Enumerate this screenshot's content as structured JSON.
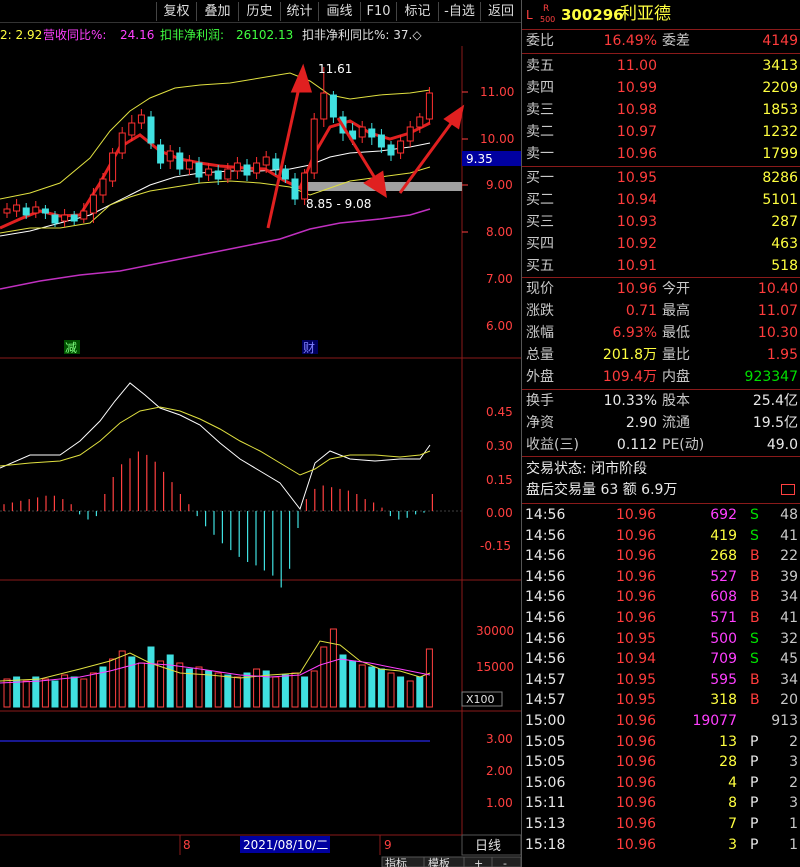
{
  "toolbar": {
    "buttons": [
      "复权",
      "叠加",
      "历史",
      "统计",
      "画线",
      "F10",
      "标记",
      "-自选",
      "返回"
    ]
  },
  "header_info": {
    "text1": "2: 2.92",
    "label2": "营收同比%: ",
    "value2": "24.16",
    "label3": "扣非净利润: ",
    "value3": "26102.13",
    "label4": "扣非净利同比%: 37.◇"
  },
  "main_chart": {
    "price_ticks": [
      "11.00",
      "10.00",
      "9.00",
      "8.00",
      "7.00",
      "6.00"
    ],
    "current_price_tag": "9.35",
    "high_label": "11.61",
    "range_label": "8.85 - 9.08",
    "event_labels": [
      "减",
      "财"
    ]
  },
  "macd_chart": {
    "ticks": [
      "0.45",
      "0.30",
      "0.15",
      "0.00",
      "-0.15"
    ]
  },
  "volume_chart": {
    "ticks": [
      "30000",
      "15000"
    ],
    "unit": "X100"
  },
  "indicator_chart": {
    "ticks": [
      "3.00",
      "2.00",
      "1.00"
    ]
  },
  "time_axis": {
    "labels": [
      "8",
      "2021/08/10/二",
      "9"
    ],
    "period": "日线",
    "bottom_buttons": [
      "指标",
      "模板",
      "+",
      "-"
    ]
  },
  "stock": {
    "code": "300296",
    "name": "利亚德",
    "badge_l": "L",
    "badge_r": "R",
    "badge_num": "500"
  },
  "order_book": {
    "weibi_label": "委比",
    "weibi_value": "16.49%",
    "weicha_label": "委差",
    "weicha_value": "4149",
    "asks": [
      {
        "label": "卖五",
        "price": "11.00",
        "vol": "3413"
      },
      {
        "label": "卖四",
        "price": "10.99",
        "vol": "2209"
      },
      {
        "label": "卖三",
        "price": "10.98",
        "vol": "1853"
      },
      {
        "label": "卖二",
        "price": "10.97",
        "vol": "1232"
      },
      {
        "label": "卖一",
        "price": "10.96",
        "vol": "1799"
      }
    ],
    "bids": [
      {
        "label": "买一",
        "price": "10.95",
        "vol": "8286"
      },
      {
        "label": "买二",
        "price": "10.94",
        "vol": "5101"
      },
      {
        "label": "买三",
        "price": "10.93",
        "vol": "287"
      },
      {
        "label": "买四",
        "price": "10.92",
        "vol": "463"
      },
      {
        "label": "买五",
        "price": "10.91",
        "vol": "518"
      }
    ]
  },
  "stats": [
    {
      "l1": "现价",
      "v1": "10.96",
      "c1": "red",
      "l2": "今开",
      "v2": "10.40",
      "c2": "red"
    },
    {
      "l1": "涨跌",
      "v1": "0.71",
      "c1": "red",
      "l2": "最高",
      "v2": "11.07",
      "c2": "red"
    },
    {
      "l1": "涨幅",
      "v1": "6.93%",
      "c1": "red",
      "l2": "最低",
      "v2": "10.30",
      "c2": "red"
    },
    {
      "l1": "总量",
      "v1": "201.8万",
      "c1": "yellow",
      "l2": "量比",
      "v2": "1.95",
      "c2": "red"
    },
    {
      "l1": "外盘",
      "v1": "109.4万",
      "c1": "red",
      "l2": "内盘",
      "v2": "923347",
      "c2": "green"
    }
  ],
  "stats2": [
    {
      "l1": "换手",
      "v1": "10.33%",
      "l2": "股本",
      "v2": "25.4亿"
    },
    {
      "l1": "净资",
      "v1": "2.90",
      "l2": "流通",
      "v2": "19.5亿"
    },
    {
      "l1": "收益(三)",
      "v1": "0.112",
      "l2": "PE(动)",
      "v2": "49.0"
    }
  ],
  "trade_status": {
    "label": "交易状态: 闭市阶段",
    "after_hours": "盘后交易量 63 额 6.9万"
  },
  "ticks": [
    {
      "time": "14:56",
      "price": "10.96",
      "vol": "692",
      "side": "S",
      "cnt": "48",
      "pc": "red",
      "vc": "magenta",
      "sc": "green"
    },
    {
      "time": "14:56",
      "price": "10.96",
      "vol": "419",
      "side": "S",
      "cnt": "41",
      "pc": "red",
      "vc": "yellow",
      "sc": "green"
    },
    {
      "time": "14:56",
      "price": "10.96",
      "vol": "268",
      "side": "B",
      "cnt": "22",
      "pc": "red",
      "vc": "yellow",
      "sc": "red"
    },
    {
      "time": "14:56",
      "price": "10.96",
      "vol": "527",
      "side": "B",
      "cnt": "39",
      "pc": "red",
      "vc": "magenta",
      "sc": "red"
    },
    {
      "time": "14:56",
      "price": "10.96",
      "vol": "608",
      "side": "B",
      "cnt": "34",
      "pc": "red",
      "vc": "magenta",
      "sc": "red"
    },
    {
      "time": "14:56",
      "price": "10.96",
      "vol": "571",
      "side": "B",
      "cnt": "41",
      "pc": "red",
      "vc": "magenta",
      "sc": "red"
    },
    {
      "time": "14:56",
      "price": "10.95",
      "vol": "500",
      "side": "S",
      "cnt": "32",
      "pc": "red",
      "vc": "magenta",
      "sc": "green"
    },
    {
      "time": "14:56",
      "price": "10.94",
      "vol": "709",
      "side": "S",
      "cnt": "45",
      "pc": "red",
      "vc": "magenta",
      "sc": "green"
    },
    {
      "time": "14:57",
      "price": "10.95",
      "vol": "595",
      "side": "B",
      "cnt": "34",
      "pc": "red",
      "vc": "magenta",
      "sc": "red"
    },
    {
      "time": "14:57",
      "price": "10.95",
      "vol": "318",
      "side": "B",
      "cnt": "20",
      "pc": "red",
      "vc": "yellow",
      "sc": "red"
    },
    {
      "time": "15:00",
      "price": "10.96",
      "vol": "19077",
      "side": "",
      "cnt": "913",
      "pc": "red",
      "vc": "magenta",
      "sc": "white"
    },
    {
      "time": "15:05",
      "price": "10.96",
      "vol": "13",
      "side": "P",
      "cnt": "2",
      "pc": "red",
      "vc": "yellow",
      "sc": "white"
    },
    {
      "time": "15:05",
      "price": "10.96",
      "vol": "28",
      "side": "P",
      "cnt": "3",
      "pc": "red",
      "vc": "yellow",
      "sc": "white"
    },
    {
      "time": "15:06",
      "price": "10.96",
      "vol": "4",
      "side": "P",
      "cnt": "2",
      "pc": "red",
      "vc": "yellow",
      "sc": "white"
    },
    {
      "time": "15:11",
      "price": "10.96",
      "vol": "8",
      "side": "P",
      "cnt": "3",
      "pc": "red",
      "vc": "yellow",
      "sc": "white"
    },
    {
      "time": "15:13",
      "price": "10.96",
      "vol": "7",
      "side": "P",
      "cnt": "1",
      "pc": "red",
      "vc": "yellow",
      "sc": "white"
    },
    {
      "time": "15:18",
      "price": "10.96",
      "vol": "3",
      "side": "P",
      "cnt": "1",
      "pc": "red",
      "vc": "yellow",
      "sc": "white"
    }
  ]
}
